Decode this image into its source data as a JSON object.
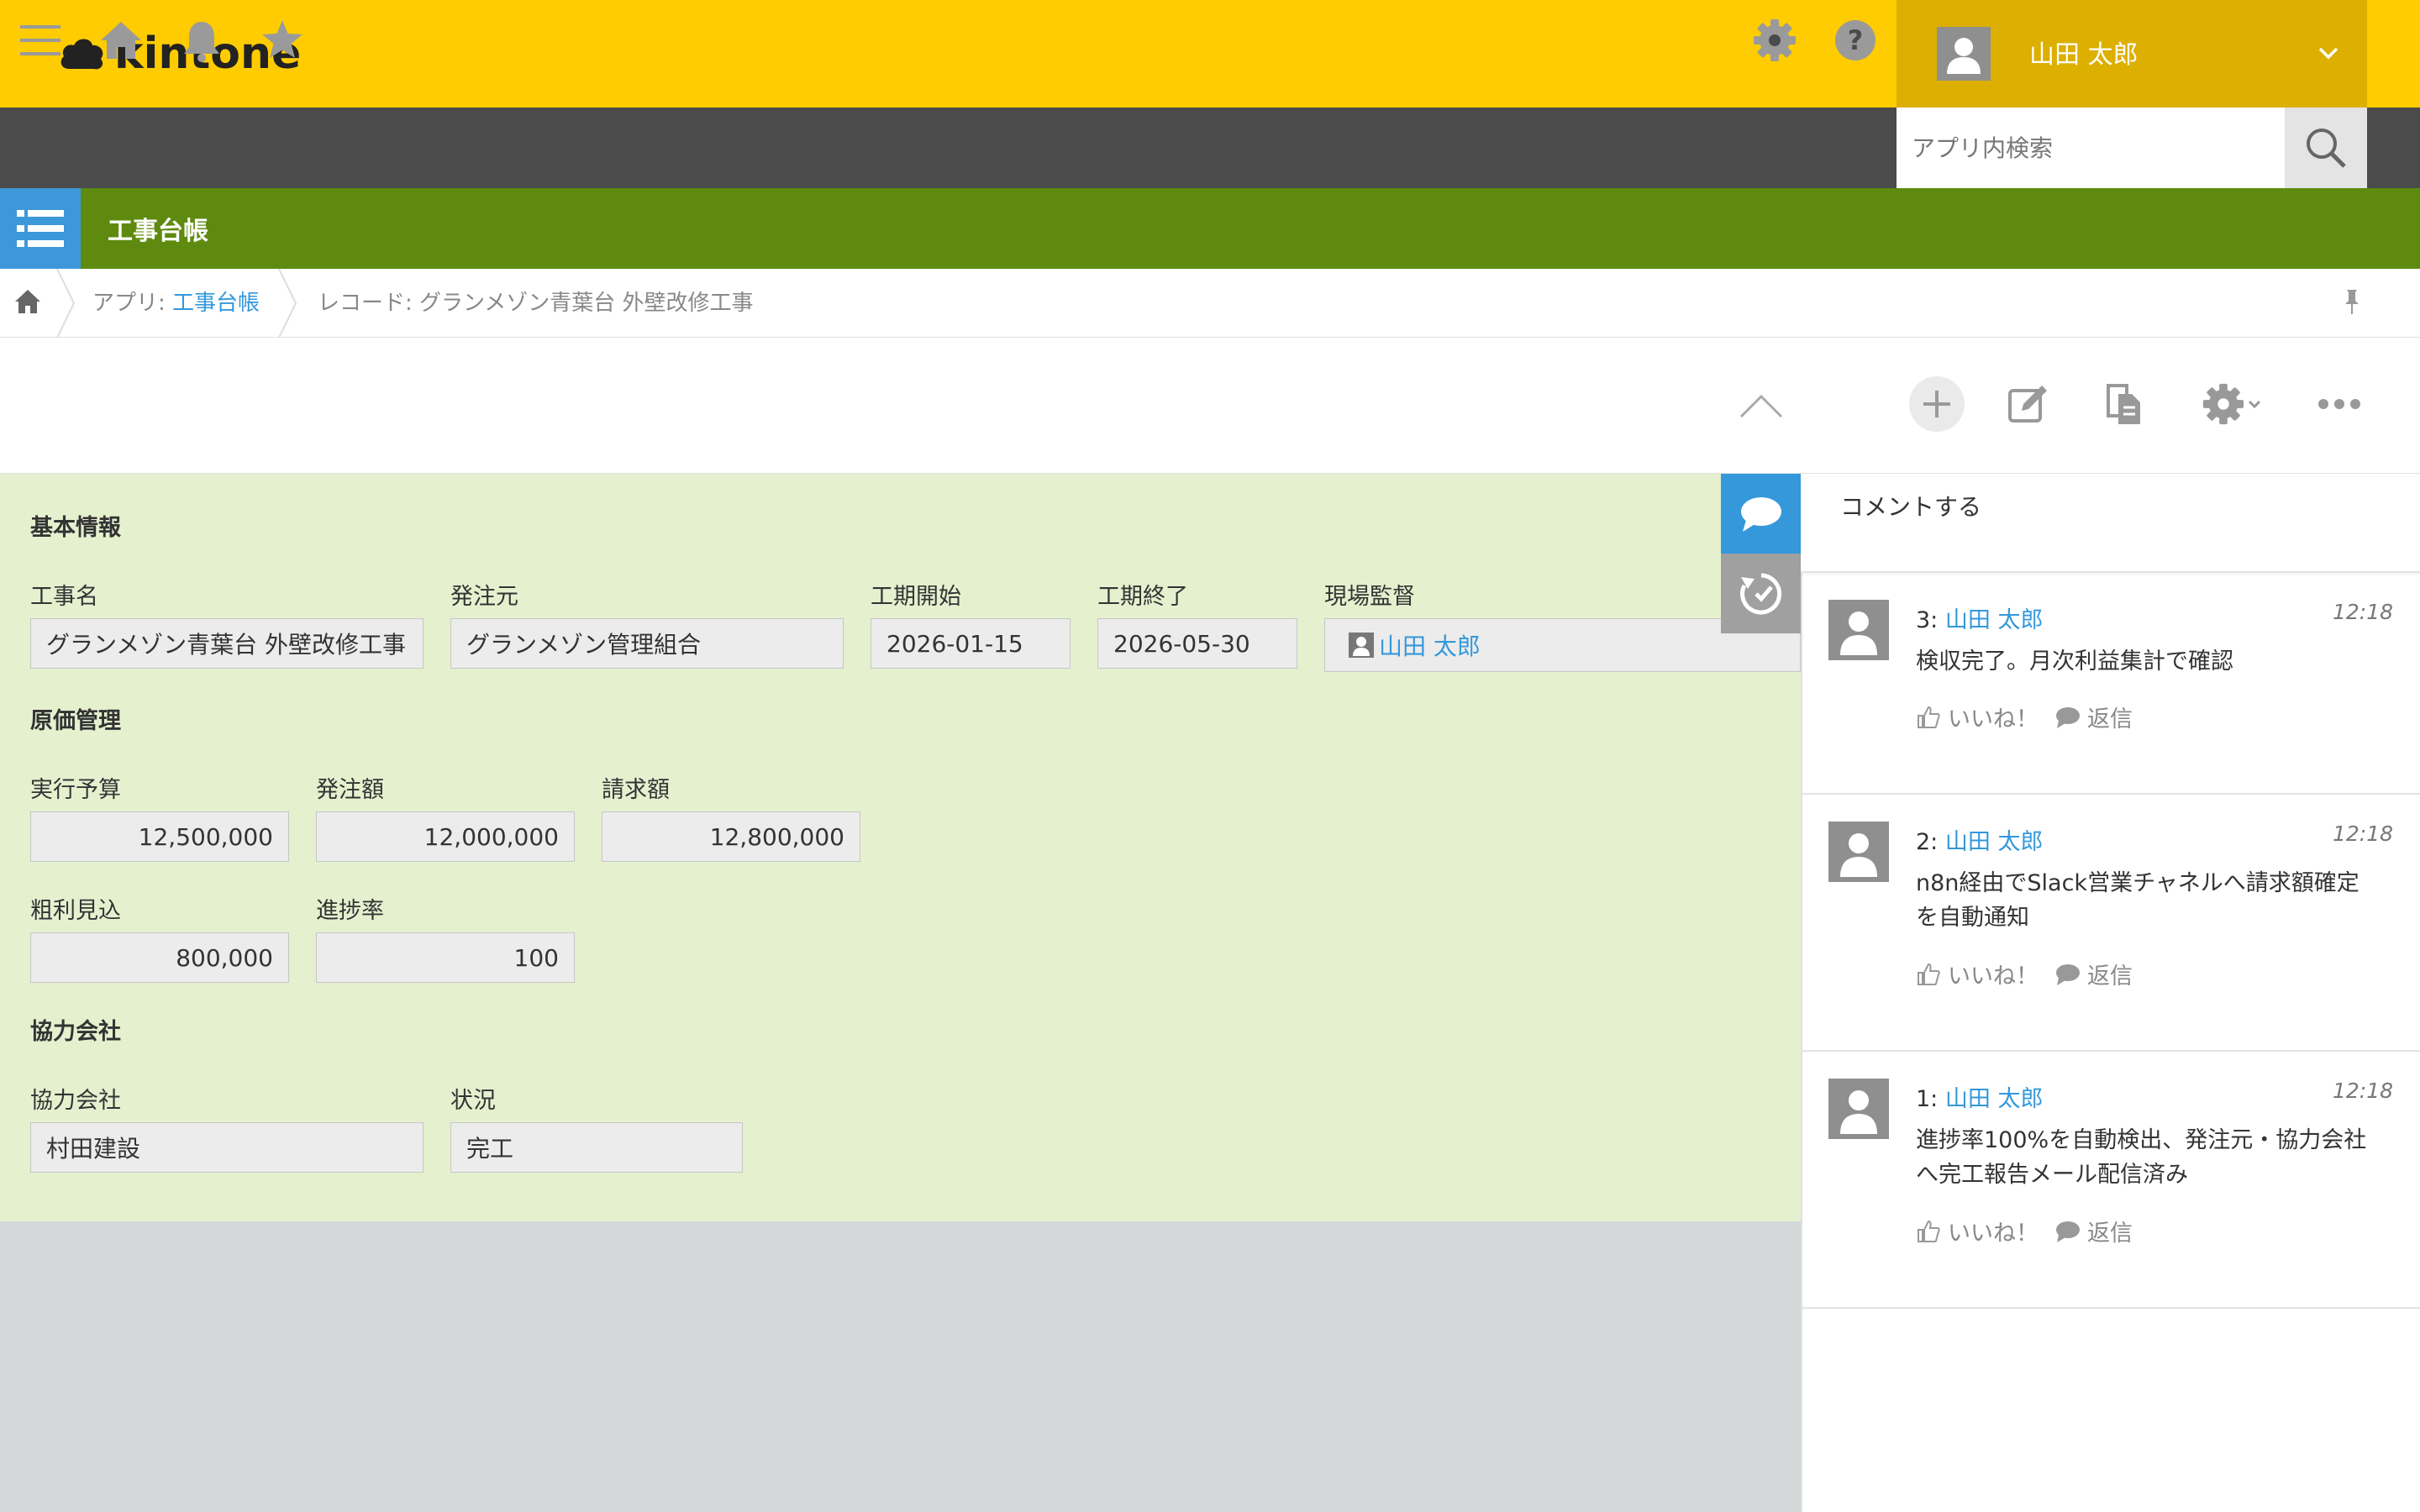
{
  "header": {
    "logo_text": "kintone",
    "user_name": "山田 太郎"
  },
  "search": {
    "placeholder": "アプリ内検索"
  },
  "app": {
    "title": "工事台帳"
  },
  "breadcrumb": {
    "app_prefix": "アプリ: ",
    "app_name": "工事台帳",
    "record_label": "レコード: グランメゾン青葉台 外壁改修工事"
  },
  "record": {
    "sections": {
      "basic": "基本情報",
      "cost": "原価管理",
      "partner": "協力会社"
    },
    "fields": {
      "project_name": {
        "label": "工事名",
        "value": "グランメゾン青葉台 外壁改修工事"
      },
      "client": {
        "label": "発注元",
        "value": "グランメゾン管理組合"
      },
      "start_date": {
        "label": "工期開始",
        "value": "2026-01-15"
      },
      "end_date": {
        "label": "工期終了",
        "value": "2026-05-30"
      },
      "supervisor": {
        "label": "現場監督",
        "value": "山田 太郎"
      },
      "budget": {
        "label": "実行予算",
        "value": "12,500,000"
      },
      "order_amount": {
        "label": "発注額",
        "value": "12,000,000"
      },
      "billing_amount": {
        "label": "請求額",
        "value": "12,800,000"
      },
      "gross_profit": {
        "label": "粗利見込",
        "value": "800,000"
      },
      "progress": {
        "label": "進捗率",
        "value": "100"
      },
      "partner_company": {
        "label": "協力会社",
        "value": "村田建設"
      },
      "status": {
        "label": "状況",
        "value": "完工"
      }
    }
  },
  "comments": {
    "input_placeholder": "コメントする",
    "like_label": "いいね！",
    "reply_label": "返信",
    "items": [
      {
        "num": "3:",
        "author": "山田 太郎",
        "time": "12:18",
        "lines": [
          "検収完了。月次利益集計で確認"
        ]
      },
      {
        "num": "2:",
        "author": "山田 太郎",
        "time": "12:18",
        "lines": [
          "n8n経由でSlack営業チャネルへ請求額確定",
          "を自動通知"
        ]
      },
      {
        "num": "1:",
        "author": "山田 太郎",
        "time": "12:18",
        "lines": [
          "進捗率100%を自動検出、発注元・協力会社",
          "へ完工報告メール配信済み"
        ]
      }
    ]
  },
  "colors": {
    "header_bg": "#fecc00",
    "nav_bg": "#4b4b4b",
    "app_bar_bg": "#5e8b0f",
    "record_bg": "#e5f0cf",
    "link": "#3498db"
  }
}
